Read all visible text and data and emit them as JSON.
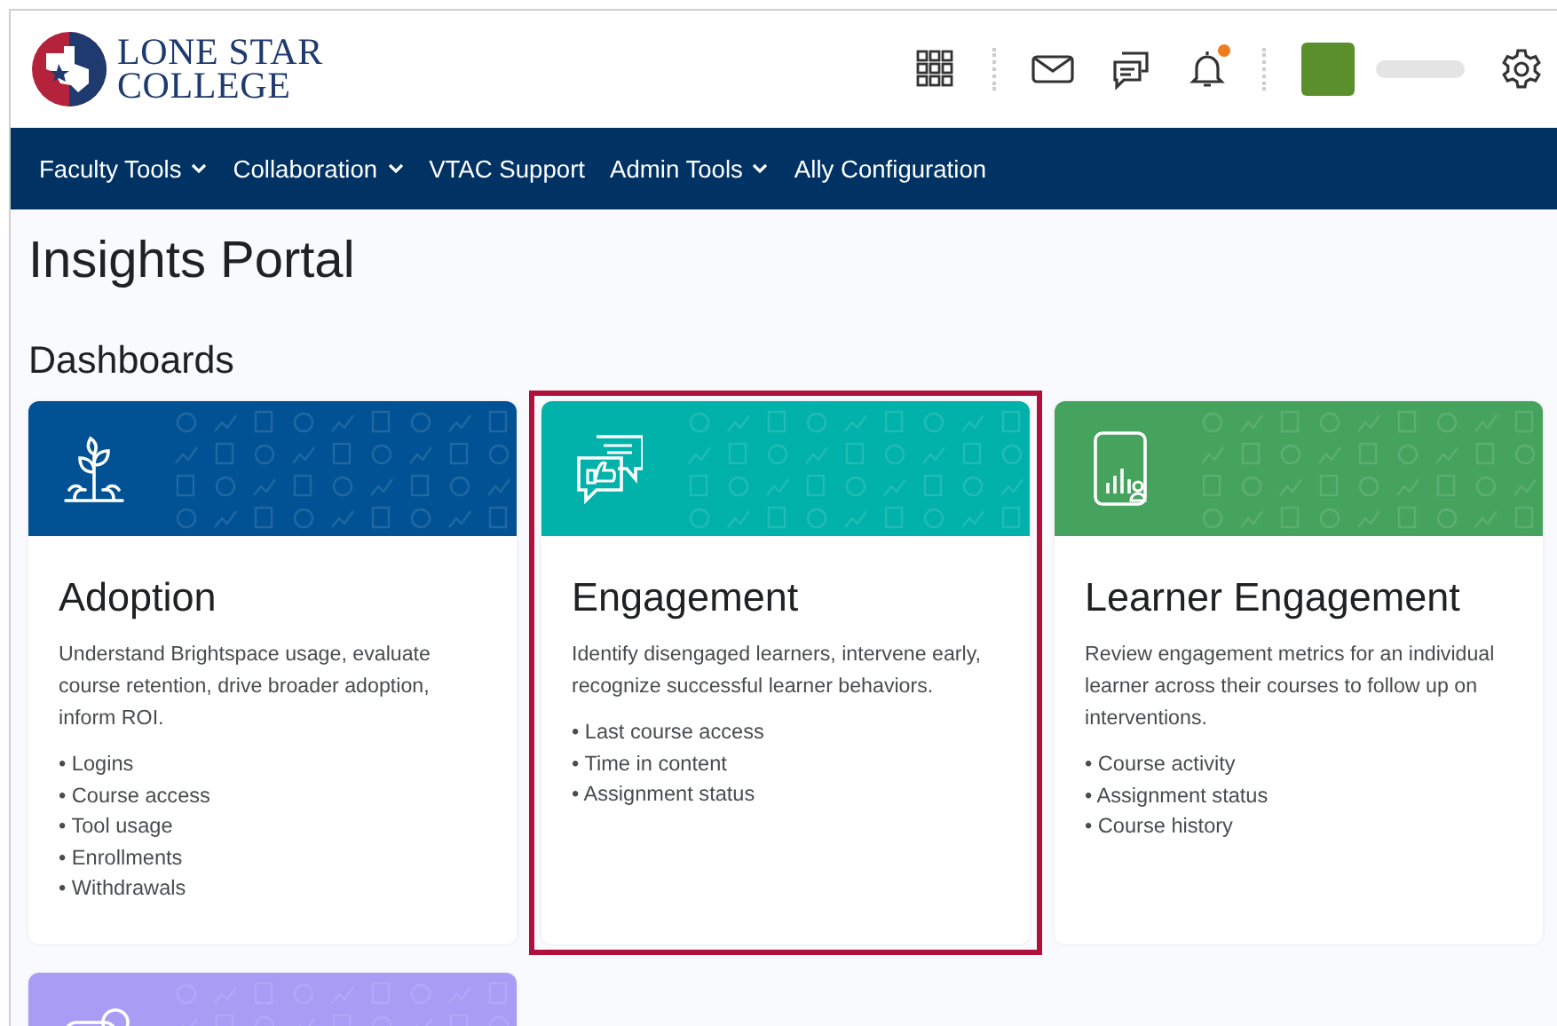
{
  "header": {
    "logo_lines": [
      "LONE STAR",
      "COLLEGE"
    ],
    "notification_unread": true
  },
  "nav": [
    {
      "label": "Faculty Tools",
      "has_menu": true
    },
    {
      "label": "Collaboration",
      "has_menu": true
    },
    {
      "label": "VTAC Support",
      "has_menu": false
    },
    {
      "label": "Admin Tools",
      "has_menu": true
    },
    {
      "label": "Ally Configuration",
      "has_menu": false
    }
  ],
  "page_title": "Insights Portal",
  "section_title": "Dashboards",
  "cards": [
    {
      "kind": "sprout",
      "color": "#005295",
      "title": "Adoption",
      "description": "Understand Brightspace usage, evaluate course retention, drive broader adoption, inform ROI.",
      "items": [
        "• Logins",
        "• Course access",
        "• Tool usage",
        "• Enrollments",
        "• Withdrawals"
      ],
      "selected": false
    },
    {
      "kind": "chat",
      "color": "#00b2aa",
      "title": "Engagement",
      "description": "Identify disengaged learners, intervene early, recognize successful learner behaviors.",
      "items": [
        "• Last course access",
        "• Time in content",
        "• Assignment status"
      ],
      "selected": true
    },
    {
      "kind": "report",
      "color": "#46a35e",
      "title": "Learner Engagement",
      "description": "Review engagement metrics for an individual learner across their courses to follow up on interventions.",
      "items": [
        "• Course activity",
        "• Assignment status",
        "• Course history"
      ],
      "selected": false
    },
    {
      "kind": "badge",
      "color": "#a89cf5",
      "selected": false
    }
  ]
}
